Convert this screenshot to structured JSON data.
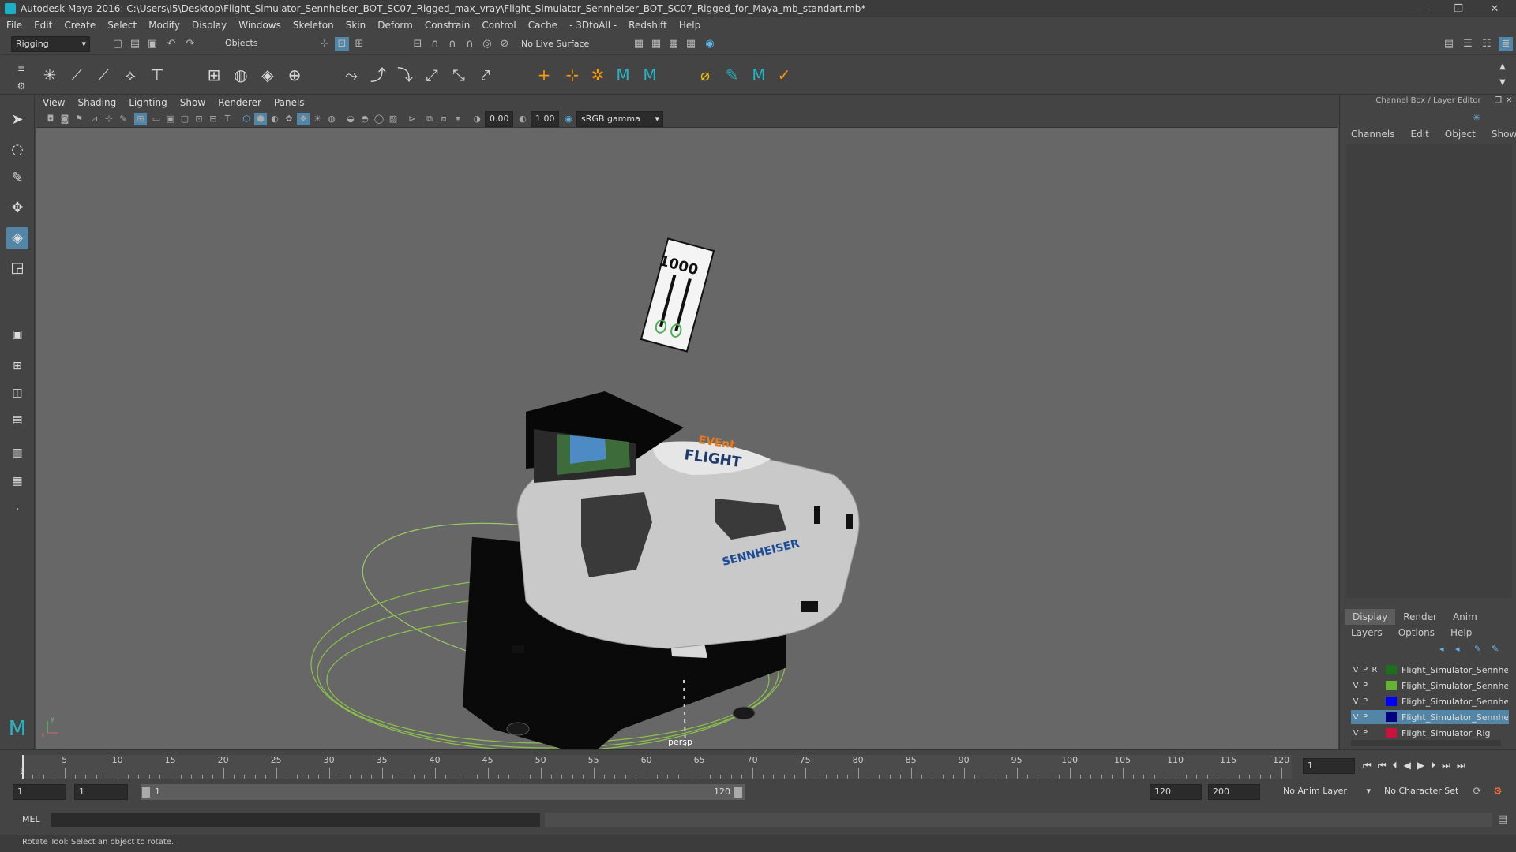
{
  "window": {
    "title": "Autodesk Maya 2016: C:\\Users\\I5\\Desktop\\Flight_Simulator_Sennheiser_BOT_SC07_Rigged_max_vray\\Flight_Simulator_Sennheiser_BOT_SC07_Rigged_for_Maya_mb_standart.mb*",
    "minimize": "—",
    "maximize": "❐",
    "close": "✕"
  },
  "menu": [
    "File",
    "Edit",
    "Create",
    "Select",
    "Modify",
    "Display",
    "Windows",
    "Skeleton",
    "Skin",
    "Deform",
    "Constrain",
    "Control",
    "Cache",
    "- 3DtoAll -",
    "Redshift",
    "Help"
  ],
  "status": {
    "menuset": "Rigging",
    "selection_mode": "Objects",
    "live_surface": "No Live Surface"
  },
  "panel": {
    "menu": [
      "View",
      "Shading",
      "Lighting",
      "Show",
      "Renderer",
      "Panels"
    ],
    "exposure": "0.00",
    "gamma": "1.00",
    "color_space": "sRGB gamma",
    "camera_label": "persp"
  },
  "scene": {
    "sign_text": "1000",
    "brand_top": "EVEnt",
    "brand_main": "FLIGHT",
    "sponsor": "SENNHEISER",
    "axis_y": "y",
    "axis_x": "x"
  },
  "channel_box": {
    "title": "Channel Box / Layer Editor",
    "menu": [
      "Channels",
      "Edit",
      "Object",
      "Show"
    ],
    "tabs": [
      "Display",
      "Render",
      "Anim"
    ],
    "layer_menu": [
      "Layers",
      "Options",
      "Help"
    ],
    "layers": [
      {
        "v": "V",
        "p": "P",
        "r": "R",
        "color": "#1e6e1e",
        "name": "Flight_Simulator_Sennheiser"
      },
      {
        "v": "V",
        "p": "P",
        "r": "",
        "color": "#64b432",
        "name": "Flight_Simulator_Sennheiser"
      },
      {
        "v": "V",
        "p": "P",
        "r": "",
        "color": "#0000ff",
        "name": "Flight_Simulator_Sennheiser"
      },
      {
        "v": "V",
        "p": "P",
        "r": "",
        "color": "#000080",
        "name": "Flight_Simulator_Sennheiser"
      },
      {
        "v": "V",
        "p": "P",
        "r": "",
        "color": "#c8143c",
        "name": "Flight_Simulator_Rig"
      }
    ]
  },
  "timeline": {
    "ticks": [
      "1",
      "5",
      "10",
      "15",
      "20",
      "25",
      "30",
      "35",
      "40",
      "45",
      "50",
      "55",
      "60",
      "65",
      "70",
      "75",
      "80",
      "85",
      "90",
      "95",
      "100",
      "105",
      "110",
      "115",
      "120"
    ],
    "current_frame": "1",
    "range_start": "1",
    "range_start2": "1",
    "slider_start": "1",
    "slider_end": "120",
    "range_end": "120",
    "range_end2": "200",
    "anim_layer": "No Anim Layer",
    "char_set": "No Character Set"
  },
  "command": {
    "lang": "MEL"
  },
  "help_line": "Rotate Tool: Select an object to rotate."
}
